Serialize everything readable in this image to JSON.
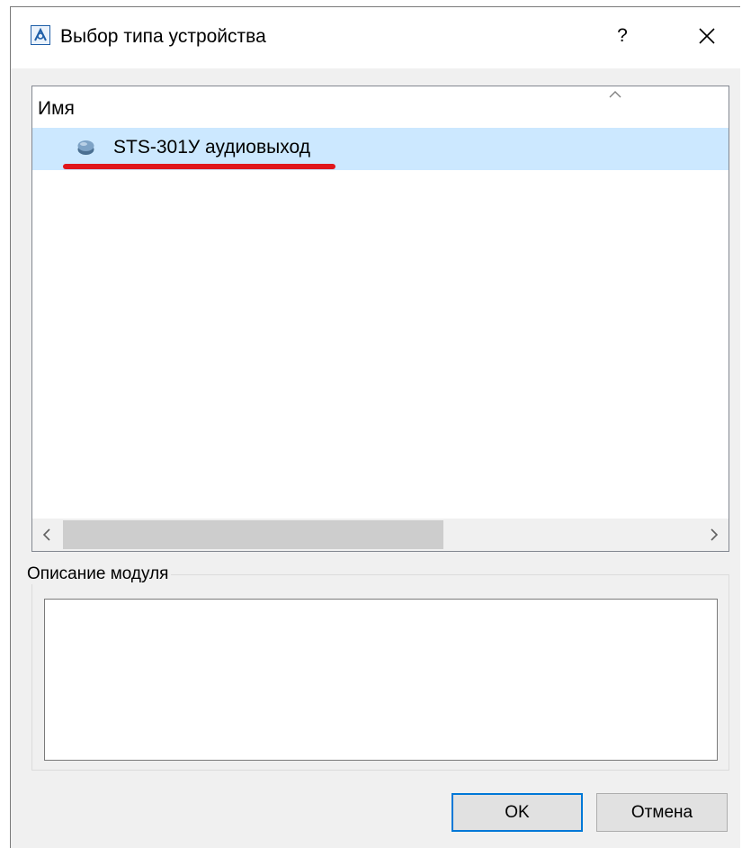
{
  "window": {
    "title": "Выбор типа устройства",
    "help_label": "?"
  },
  "list": {
    "column_header": "Имя",
    "items": [
      {
        "label": "STS-301У аудиовыход",
        "icon": "device-icon",
        "selected": true
      }
    ]
  },
  "description": {
    "group_label": "Описание модуля",
    "text": ""
  },
  "buttons": {
    "ok_label": "OK",
    "cancel_label": "Отмена"
  },
  "colors": {
    "selection": "#cce8ff",
    "highlight_underline": "#e0161c",
    "default_button_border": "#0078d7"
  }
}
